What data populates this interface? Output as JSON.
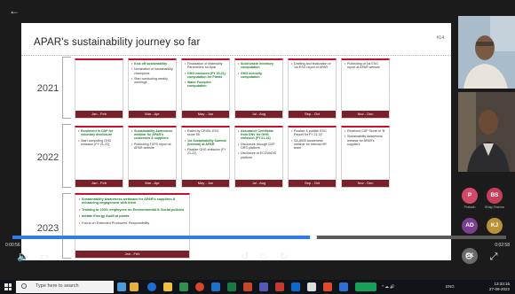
{
  "slide": {
    "title": "APAR's sustainability journey so far",
    "slide_no": "#14"
  },
  "years": [
    "2021",
    "2022",
    "2023"
  ],
  "row2021": [
    {
      "month": "Jan - Feb",
      "items": []
    },
    {
      "month": "Mar - Apr",
      "items": [
        {
          "text": "Kick off sustainability",
          "hl": true
        },
        {
          "text": "Nomination of sustainability champions",
          "hl": false
        },
        {
          "text": "Start conducting weekly meetings",
          "hl": false
        }
      ]
    },
    {
      "month": "May - Jun",
      "items": [
        {
          "text": "Finalization of Materiality Parameters for Apar",
          "hl": false
        },
        {
          "text": "GHG emission (FY 20-21) computation for Plants",
          "hl": true
        },
        {
          "text": "Water Footprint computation",
          "hl": true
        }
      ]
    },
    {
      "month": "Jul - Aug",
      "items": [
        {
          "text": "Solid waste inventory computation",
          "hl": true
        },
        {
          "text": "GHG intensity computation",
          "hl": true
        }
      ]
    },
    {
      "month": "Sep - Oct",
      "items": [
        {
          "text": "Drafting and finalization of 1st ESG report of APAR",
          "hl": false
        }
      ]
    },
    {
      "month": "Nov - Dec",
      "items": [
        {
          "text": "Publishing of 1st ESG report at APAR website",
          "hl": false
        }
      ]
    }
  ],
  "row2022": [
    {
      "month": "Jan - Feb",
      "items": [
        {
          "text": "Enrolment in CDP for voluntary disclosure",
          "hl": true
        },
        {
          "text": "Start computing GHG emission (FY 21-22)",
          "hl": false
        }
      ]
    },
    {
      "month": "Mar - Apr",
      "items": [
        {
          "text": "Sustainability Awareness webinar for APAR's customers & suppliers",
          "hl": true
        },
        {
          "text": "Publishing TCFD report at APAR website",
          "hl": false
        }
      ]
    },
    {
      "month": "May - Jun",
      "items": [
        {
          "text": "Rated by CRISIL ESG score 55",
          "hl": false
        },
        {
          "text": "1st Sustainability Summit (Internal) at APAR",
          "hl": true
        },
        {
          "text": "Finalize GHG emission (FY 21-22)",
          "hl": false
        }
      ]
    },
    {
      "month": "Jul - Aug",
      "items": [
        {
          "text": "Assurance Certificate from DNV for GHG emission (FY 21-22)",
          "hl": true
        },
        {
          "text": "Disclosure through CDP ORS platform",
          "hl": false
        },
        {
          "text": "Disclosure at ECOVADIS platform",
          "hl": false
        }
      ]
    },
    {
      "month": "Sep - Oct",
      "items": [
        {
          "text": "Finalize & publish ESG Report for FY 21-22",
          "hl": false
        },
        {
          "text": "SA-8000 Awareness webinar for internal HR team",
          "hl": false
        }
      ]
    },
    {
      "month": "Nov - Dec",
      "items": [
        {
          "text": "Received CDP Score of 'B'",
          "hl": false
        },
        {
          "text": "Sustainability Awareness webinar for APAR's suppliers",
          "hl": false
        }
      ]
    }
  ],
  "row2023": {
    "month": "Jan - Feb",
    "items": [
      {
        "text": "Sustainability Awareness webinars for APAR's suppliers & enhancing engagement with them",
        "hl": true
      },
      {
        "text": "Training to 100% employees on Environmental & Social policies",
        "hl": true
      },
      {
        "text": "Initiate Energy Audit at plants",
        "hl": true
      },
      {
        "text": "Focus on Extended Producers' Responsibility",
        "hl": false
      }
    ]
  },
  "participants": {
    "avatars": [
      {
        "initials": "P",
        "label": "Prakash",
        "color": "#d24a6b"
      },
      {
        "initials": "BS",
        "label": "Bhag Sharma",
        "color": "#c43f5c"
      },
      {
        "initials": "AD",
        "label": "ad Ganesan",
        "color": "#7a3f8e"
      },
      {
        "initials": "KJ",
        "label": "Kavita Jha",
        "color": "#b8913a"
      },
      {
        "initials": "SK",
        "label": "",
        "color": "#6b6b6b"
      }
    ]
  },
  "player": {
    "time_elapsed": "0:00:56",
    "time_total": "0:02:58",
    "progress": 0.61
  },
  "taskbar": {
    "search_placeholder": "Type here to search",
    "lang": "ENG",
    "time": "13:33:16",
    "date": "27-09-2022"
  },
  "colors": {
    "accent": "#c8102e",
    "month_bar": "#7b1f28",
    "highlight_text": "#1c7f2c",
    "progress": "#2f7ee6"
  }
}
